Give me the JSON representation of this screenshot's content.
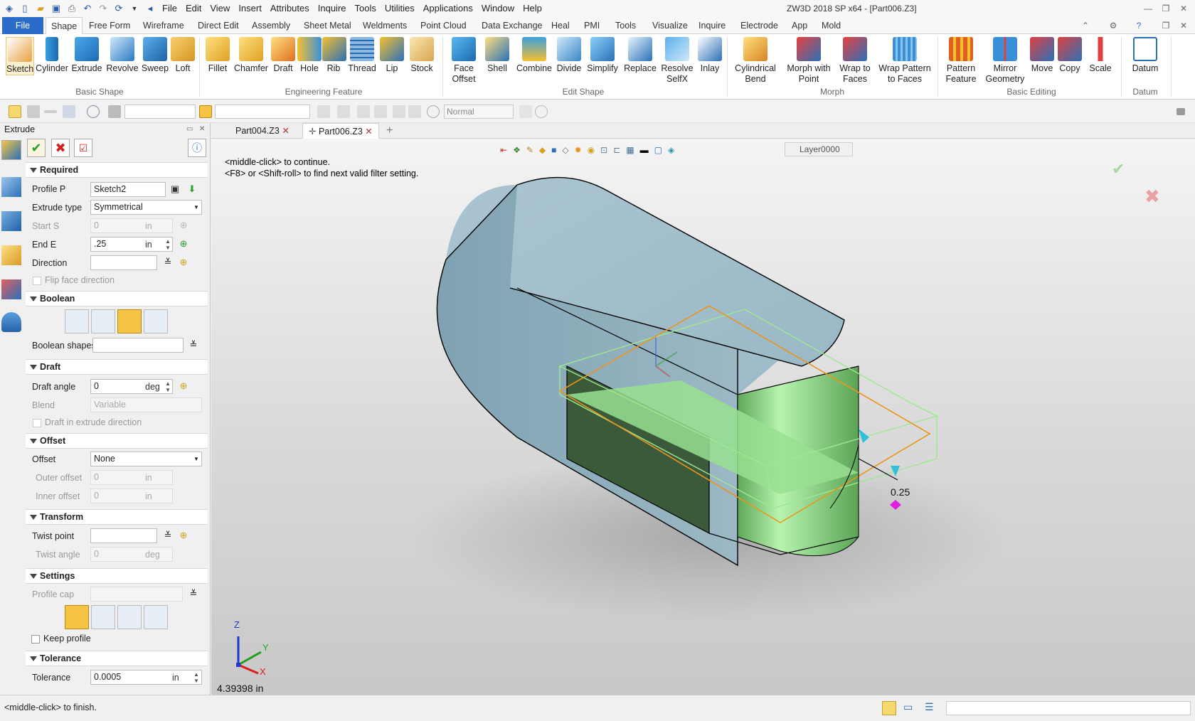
{
  "title": "ZW3D 2018 SP x64 - [Part006.Z3]",
  "menu": [
    "File",
    "Edit",
    "View",
    "Insert",
    "Attributes",
    "Inquire",
    "Tools",
    "Utilities",
    "Applications",
    "Window",
    "Help"
  ],
  "ribbon_tabs": [
    "File",
    "Shape",
    "Free Form",
    "Wireframe",
    "Direct Edit",
    "Assembly",
    "Sheet Metal",
    "Weldments",
    "Point Cloud",
    "Data Exchange",
    "Heal",
    "PMI",
    "Tools",
    "Visualize",
    "Inquire",
    "Electrode",
    "App",
    "Mold"
  ],
  "ribbon": {
    "basic_shape": {
      "label": "Basic Shape",
      "items": [
        "Sketch",
        "Cylinder",
        "Extrude",
        "Revolve",
        "Sweep",
        "Loft"
      ]
    },
    "engineering_feature": {
      "label": "Engineering Feature",
      "items": [
        "Fillet",
        "Chamfer",
        "Draft",
        "Hole",
        "Rib",
        "Thread",
        "Lip",
        "Stock"
      ]
    },
    "edit_shape": {
      "label": "Edit Shape",
      "items": [
        "Face Offset",
        "Shell",
        "Combine",
        "Divide",
        "Simplify",
        "Replace",
        "Resolve SelfX",
        "Inlay"
      ]
    },
    "morph": {
      "label": "Morph",
      "items": [
        "Cylindrical Bend",
        "Morph with Point",
        "Wrap to Faces",
        "Wrap Pattern to Faces"
      ]
    },
    "basic_editing": {
      "label": "Basic Editing",
      "items": [
        "Pattern Feature",
        "Mirror Geometry",
        "Move",
        "Copy",
        "Scale"
      ]
    },
    "datum": {
      "label": "Datum",
      "items": [
        "Datum"
      ]
    }
  },
  "toolbar2": {
    "render_mode": "Normal"
  },
  "panel": {
    "title": "Extrude",
    "required": {
      "label": "Required",
      "profile_label": "Profile P",
      "profile_value": "Sketch2",
      "type_label": "Extrude type",
      "type_value": "Symmetrical",
      "start_label": "Start S",
      "start_value": "0",
      "end_label": "End E",
      "end_value": ".25",
      "unit": "in",
      "direction_label": "Direction",
      "flip_label": "Flip face direction"
    },
    "boolean": {
      "label": "Boolean",
      "shapes_label": "Boolean shapes"
    },
    "draft": {
      "label": "Draft",
      "angle_label": "Draft angle",
      "angle_value": "0",
      "angle_unit": "deg",
      "blend_label": "Blend",
      "blend_value": "Variable",
      "dir_label": "Draft in extrude direction"
    },
    "offset": {
      "label": "Offset",
      "offset_label": "Offset",
      "offset_value": "None",
      "outer_label": "Outer offset",
      "outer_value": "0",
      "inner_label": "Inner offset",
      "inner_value": "0",
      "unit": "in"
    },
    "transform": {
      "label": "Transform",
      "twist_point_label": "Twist point",
      "twist_angle_label": "Twist angle",
      "twist_angle_value": "0",
      "twist_unit": "deg"
    },
    "settings": {
      "label": "Settings",
      "cap_label": "Profile cap",
      "keep_label": "Keep profile"
    },
    "tolerance": {
      "label": "Tolerance",
      "tol_label": "Tolerance",
      "tol_value": "0.0005",
      "unit": "in"
    }
  },
  "doc_tabs": [
    "Part004.Z3",
    "Part006.Z3"
  ],
  "viewport": {
    "hint1": "<middle-click> to continue.",
    "hint2": "<F8> or <Shift-roll> to find next valid filter setting.",
    "layer": "Layer0000",
    "dimension": "0.25",
    "measure": "4.39398 in",
    "axis_z": "Z",
    "axis_y": "Y",
    "axis_x": "X"
  },
  "status": {
    "text": "<middle-click> to finish."
  },
  "colors": {
    "accent": "#2b6cc8",
    "body": "#92b4c4",
    "green": "#8ee08a",
    "orange": "#e8961e"
  }
}
